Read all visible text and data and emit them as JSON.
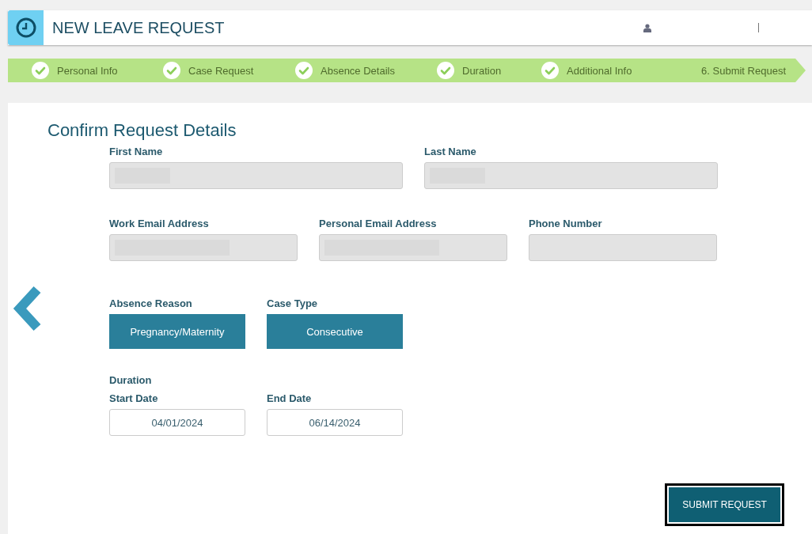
{
  "header": {
    "title": "NEW LEAVE REQUEST"
  },
  "steps": [
    {
      "label": "Personal Info",
      "completed": true
    },
    {
      "label": "Case Request",
      "completed": true
    },
    {
      "label": "Absence Details",
      "completed": true
    },
    {
      "label": "Duration",
      "completed": true
    },
    {
      "label": "Additional Info",
      "completed": true
    },
    {
      "label": "6. Submit Request",
      "completed": false
    }
  ],
  "form": {
    "title": "Confirm Request Details",
    "name_row": [
      {
        "label": "First Name",
        "redacted": true
      },
      {
        "label": "Last Name",
        "redacted": true
      }
    ],
    "contact_row": [
      {
        "label": "Work Email Address",
        "redacted": true
      },
      {
        "label": "Personal Email Address",
        "redacted": true
      },
      {
        "label": "Phone Number",
        "redacted": false
      }
    ],
    "choices": [
      {
        "label": "Absence Reason",
        "value": "Pregnancy/Maternity"
      },
      {
        "label": "Case Type",
        "value": "Consecutive"
      }
    ],
    "duration": {
      "title": "Duration",
      "dates": [
        {
          "label": "Start Date",
          "value": "04/01/2024"
        },
        {
          "label": "End Date",
          "value": "06/14/2024"
        }
      ]
    },
    "submit": "SUBMIT REQUEST"
  }
}
